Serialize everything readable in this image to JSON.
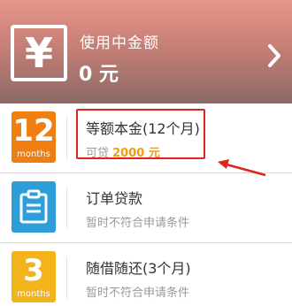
{
  "header": {
    "icon_symbol": "¥",
    "title": "使用中金额",
    "amount": "0 元"
  },
  "loans": [
    {
      "icon": "calendar-12-months-icon",
      "icon_number": "12",
      "icon_label": "months",
      "title": "等额本金(12个月)",
      "sub_prefix": "可贷 ",
      "sub_amount": "2000 元",
      "highlighted": true
    },
    {
      "icon": "order-document-icon",
      "title": "订单贷款",
      "sub": "暂时不符合申请条件"
    },
    {
      "icon": "calendar-3-months-icon",
      "icon_number": "3",
      "icon_label": "months",
      "title": "随借随还(3个月)",
      "sub": "暂时不符合申请条件"
    }
  ],
  "colors": {
    "orange": "#ef7f12",
    "yellow": "#f3b41b",
    "blue": "#2e9edb",
    "highlight_red": "#e2221c",
    "amount_orange": "#f39c11"
  }
}
